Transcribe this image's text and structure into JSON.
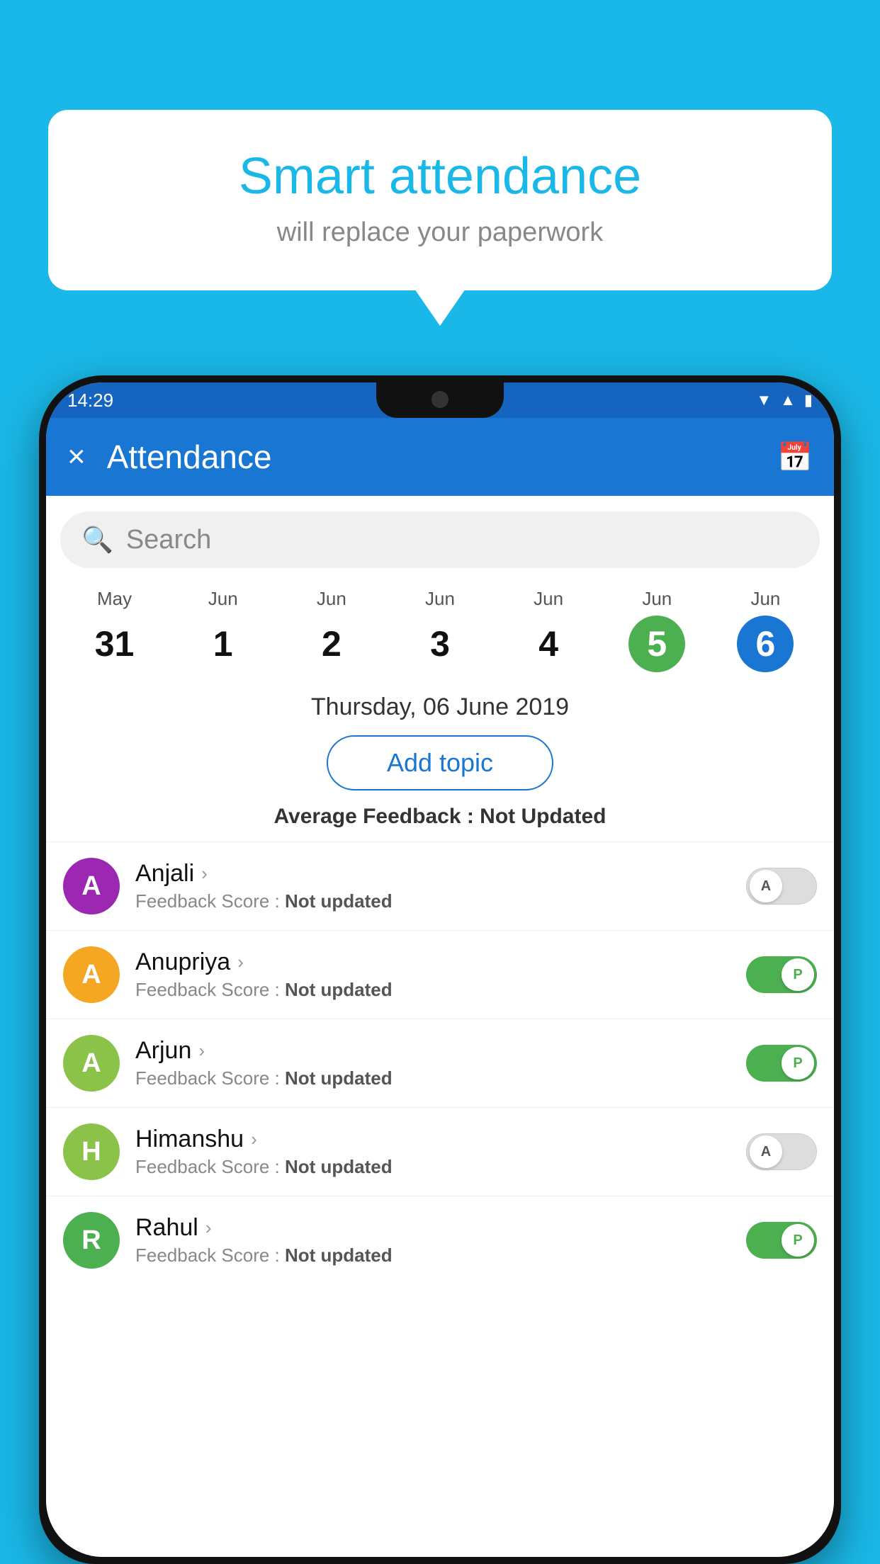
{
  "background_color": "#1ab8e8",
  "bubble": {
    "title": "Smart attendance",
    "subtitle": "will replace your paperwork"
  },
  "status_bar": {
    "time": "14:29",
    "icons": [
      "wifi",
      "signal",
      "battery"
    ]
  },
  "app_bar": {
    "title": "Attendance",
    "close_label": "×",
    "calendar_icon": "📅"
  },
  "search": {
    "placeholder": "Search"
  },
  "calendar": {
    "dates": [
      {
        "month": "May",
        "day": "31",
        "style": "normal"
      },
      {
        "month": "Jun",
        "day": "1",
        "style": "normal"
      },
      {
        "month": "Jun",
        "day": "2",
        "style": "normal"
      },
      {
        "month": "Jun",
        "day": "3",
        "style": "normal"
      },
      {
        "month": "Jun",
        "day": "4",
        "style": "normal"
      },
      {
        "month": "Jun",
        "day": "5",
        "style": "green"
      },
      {
        "month": "Jun",
        "day": "6",
        "style": "blue"
      }
    ],
    "selected_date": "Thursday, 06 June 2019"
  },
  "add_topic_button": "Add topic",
  "average_feedback": {
    "label": "Average Feedback : ",
    "value": "Not Updated"
  },
  "students": [
    {
      "name": "Anjali",
      "avatar_letter": "A",
      "avatar_color": "#9c27b0",
      "feedback_label": "Feedback Score : ",
      "feedback_value": "Not updated",
      "toggle": "off",
      "toggle_letter": "A"
    },
    {
      "name": "Anupriya",
      "avatar_letter": "A",
      "avatar_color": "#f5a623",
      "feedback_label": "Feedback Score : ",
      "feedback_value": "Not updated",
      "toggle": "on",
      "toggle_letter": "P"
    },
    {
      "name": "Arjun",
      "avatar_letter": "A",
      "avatar_color": "#8bc34a",
      "feedback_label": "Feedback Score : ",
      "feedback_value": "Not updated",
      "toggle": "on",
      "toggle_letter": "P"
    },
    {
      "name": "Himanshu",
      "avatar_letter": "H",
      "avatar_color": "#8bc34a",
      "feedback_label": "Feedback Score : ",
      "feedback_value": "Not updated",
      "toggle": "off",
      "toggle_letter": "A"
    },
    {
      "name": "Rahul",
      "avatar_letter": "R",
      "avatar_color": "#4caf50",
      "feedback_label": "Feedback Score : ",
      "feedback_value": "Not updated",
      "toggle": "on",
      "toggle_letter": "P"
    }
  ]
}
